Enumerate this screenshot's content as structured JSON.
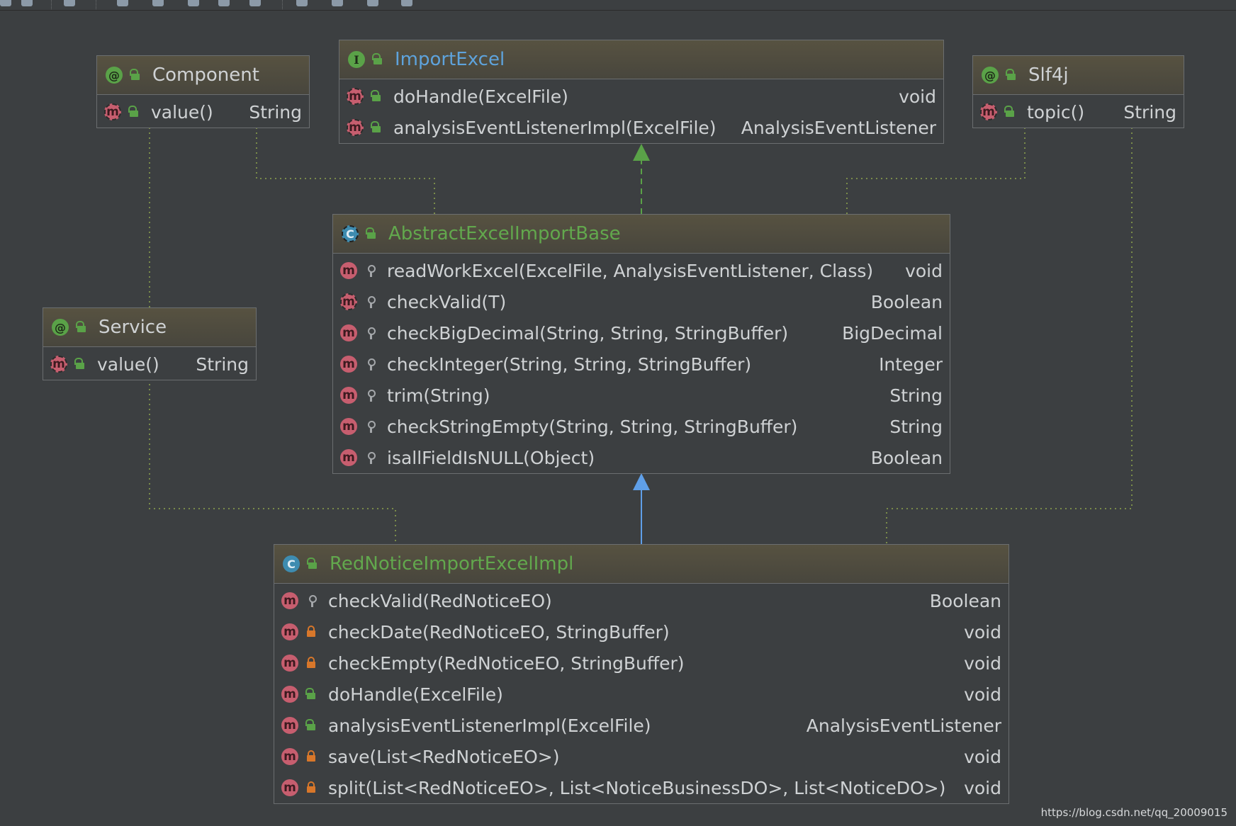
{
  "colors": {
    "background": "#3c3f41",
    "implements_arrow": "#5aa248",
    "extends_arrow": "#5f9fe8",
    "annotation_link": "#7a8c4a"
  },
  "nodes": {
    "component": {
      "kind": "annotation",
      "title": "Component",
      "members": [
        {
          "name": "value()",
          "return": "String",
          "visibility": "public"
        }
      ]
    },
    "import_excel": {
      "kind": "interface",
      "title": "ImportExcel",
      "members": [
        {
          "name": "doHandle(ExcelFile)",
          "return": "void",
          "visibility": "public"
        },
        {
          "name": "analysisEventListenerImpl(ExcelFile)",
          "return": "AnalysisEventListener",
          "visibility": "public"
        }
      ]
    },
    "slf4j": {
      "kind": "annotation",
      "title": "Slf4j",
      "members": [
        {
          "name": "topic()",
          "return": "String",
          "visibility": "public"
        }
      ]
    },
    "service": {
      "kind": "annotation",
      "title": "Service",
      "members": [
        {
          "name": "value()",
          "return": "String",
          "visibility": "public"
        }
      ]
    },
    "abstract_base": {
      "kind": "abstract-class",
      "title": "AbstractExcelImportBase",
      "members": [
        {
          "name": "readWorkExcel(ExcelFile, AnalysisEventListener, Class)",
          "return": "void",
          "visibility": "protected"
        },
        {
          "name": "checkValid(T)",
          "return": "Boolean",
          "visibility": "protected",
          "abstract": true
        },
        {
          "name": "checkBigDecimal(String, String, StringBuffer)",
          "return": "BigDecimal",
          "visibility": "protected"
        },
        {
          "name": "checkInteger(String, String, StringBuffer)",
          "return": "Integer",
          "visibility": "protected"
        },
        {
          "name": "trim(String)",
          "return": "String",
          "visibility": "protected"
        },
        {
          "name": "checkStringEmpty(String, String, StringBuffer)",
          "return": "String",
          "visibility": "protected"
        },
        {
          "name": "isallFieldIsNULL(Object)",
          "return": "Boolean",
          "visibility": "protected"
        }
      ]
    },
    "impl": {
      "kind": "class",
      "title": "RedNoticeImportExcelImpl",
      "members": [
        {
          "name": "checkValid(RedNoticeEO)",
          "return": "Boolean",
          "visibility": "protected"
        },
        {
          "name": "checkDate(RedNoticeEO, StringBuffer)",
          "return": "void",
          "visibility": "private"
        },
        {
          "name": "checkEmpty(RedNoticeEO, StringBuffer)",
          "return": "void",
          "visibility": "private"
        },
        {
          "name": "doHandle(ExcelFile)",
          "return": "void",
          "visibility": "public"
        },
        {
          "name": "analysisEventListenerImpl(ExcelFile)",
          "return": "AnalysisEventListener",
          "visibility": "public"
        },
        {
          "name": "save(List<RedNoticeEO>)",
          "return": "void",
          "visibility": "private"
        },
        {
          "name": "split(List<RedNoticeEO>, List<NoticeBusinessDO>, List<NoticeDO>)",
          "return": "void",
          "visibility": "private"
        }
      ]
    }
  },
  "icon_letters": {
    "annotation": "@",
    "interface": "I",
    "class": "C",
    "method": "m"
  },
  "watermark": "https://blog.csdn.net/qq_20009015"
}
